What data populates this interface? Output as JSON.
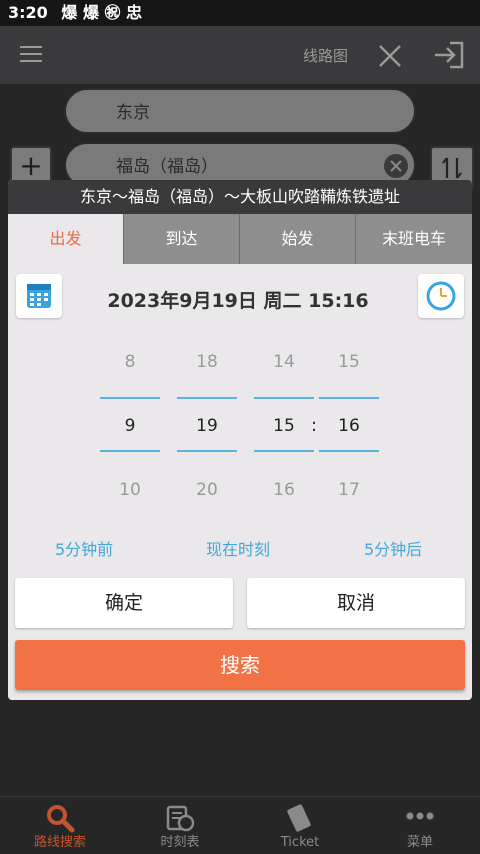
{
  "status": {
    "time": "3:20",
    "icons": "爆 爆 ㊗ 忠"
  },
  "topbar": {
    "map_label": "线路图"
  },
  "route": {
    "from": "东京",
    "to": "福岛（福岛）"
  },
  "dialog": {
    "title": "东京〜福岛（福岛）〜大板山吹踏鞴炼铁遗址",
    "tabs": [
      {
        "label": "出发",
        "active": true
      },
      {
        "label": "到达",
        "active": false
      },
      {
        "label": "始发",
        "active": false
      },
      {
        "label": "末班电车",
        "active": false
      }
    ],
    "datetime": "2023年9月19日 周二 15:16",
    "picker": {
      "month": {
        "prev": "8",
        "value": "9",
        "next": "10"
      },
      "day": {
        "prev": "18",
        "value": "19",
        "next": "20"
      },
      "hour": {
        "prev": "14",
        "value": "15",
        "next": "16"
      },
      "minute": {
        "prev": "15",
        "value": "16",
        "next": "17"
      },
      "separator": ":"
    },
    "quick": {
      "before": "5分钟前",
      "now": "现在时刻",
      "after": "5分钟后"
    },
    "confirm": "确定",
    "cancel": "取消",
    "search": "搜索"
  },
  "nav": [
    {
      "label": "路线搜索",
      "icon": "magnifier-icon",
      "active": true
    },
    {
      "label": "时刻表",
      "icon": "timetable-icon",
      "active": false
    },
    {
      "label": "Ticket",
      "icon": "ticket-icon",
      "active": false
    },
    {
      "label": "菜单",
      "icon": "more-dots-icon",
      "active": false
    }
  ],
  "colors": {
    "accent": "#f07245",
    "active_tab": "#f06a3c",
    "picker_line": "#59b4e0"
  }
}
